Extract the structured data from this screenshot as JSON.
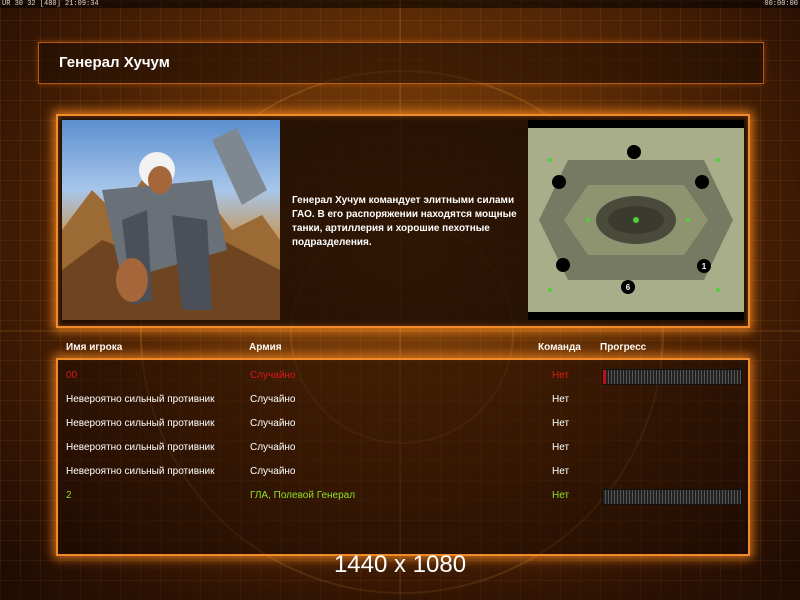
{
  "system_bar": {
    "left": "UR 30 32 [480] 21:09:34",
    "right": "00:00:00"
  },
  "title": "Генерал Хучум",
  "description": "Генерал Хучум командует элитными силами ГАО. В его распоряжении находятся мощные танки, артиллерия и хорошие пехотные подразделения.",
  "minimap": {
    "start_markers": [
      "1",
      "6"
    ]
  },
  "columns": {
    "player": "Имя игрока",
    "army": "Армия",
    "team": "Команда",
    "progress": "Прогресс"
  },
  "rows": [
    {
      "name": "00",
      "army": "Случайно",
      "team": "Нет",
      "color": "#e01818",
      "show_progress": true,
      "progress": 0.02
    },
    {
      "name": "Невероятно сильный противник",
      "army": "Случайно",
      "team": "Нет",
      "color": "#ffffff",
      "show_progress": false
    },
    {
      "name": "Невероятно сильный противник",
      "army": "Случайно",
      "team": "Нет",
      "color": "#ffffff",
      "show_progress": false
    },
    {
      "name": "Невероятно сильный противник",
      "army": "Случайно",
      "team": "Нет",
      "color": "#ffffff",
      "show_progress": false
    },
    {
      "name": "Невероятно сильный противник",
      "army": "Случайно",
      "team": "Нет",
      "color": "#ffffff",
      "show_progress": false
    },
    {
      "name": "2",
      "army": "ГЛА, Полевой Генерал",
      "team": "Нет",
      "color": "#8fe02a",
      "show_progress": true,
      "progress": 0
    }
  ],
  "resolution_label": "1440 x 1080",
  "accent_color": "#f08a2a"
}
